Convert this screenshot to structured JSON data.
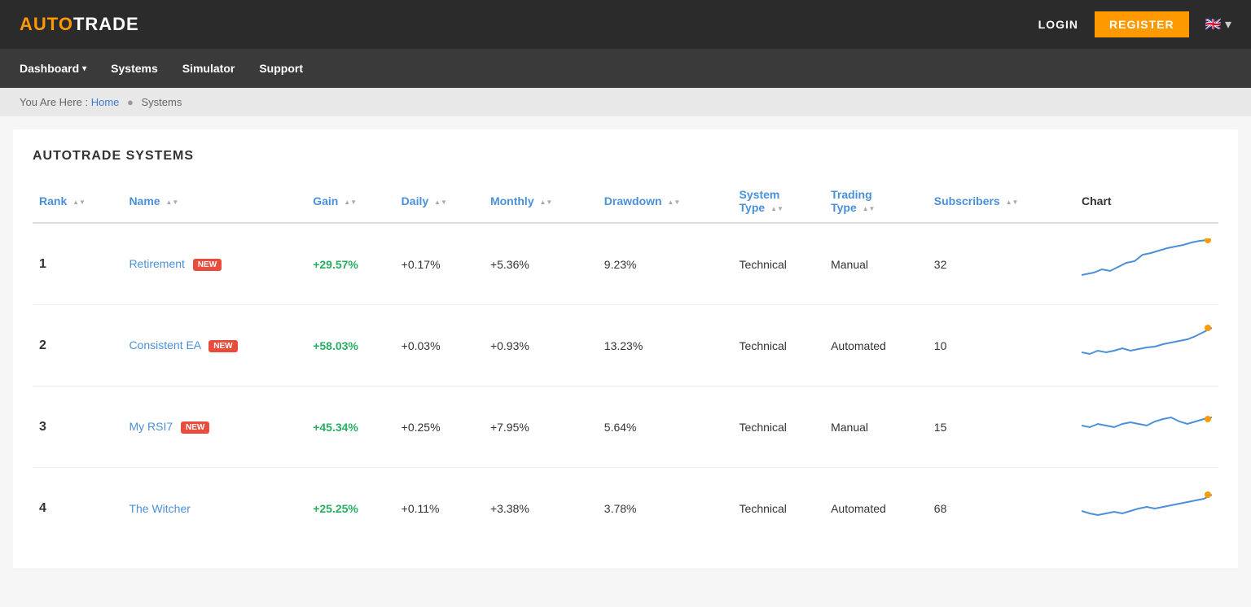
{
  "header": {
    "logo_auto": "AUTO",
    "logo_trade": "TRADE",
    "login_label": "LOGIN",
    "register_label": "REGISTER",
    "flag": "🇬🇧"
  },
  "nav": {
    "items": [
      {
        "label": "Dashboard",
        "has_caret": true
      },
      {
        "label": "Systems",
        "has_caret": false
      },
      {
        "label": "Simulator",
        "has_caret": false
      },
      {
        "label": "Support",
        "has_caret": false
      }
    ]
  },
  "breadcrumb": {
    "you_are_here": "You Are Here :",
    "home_label": "Home",
    "sep": "●",
    "current": "Systems"
  },
  "section_title": "AUTOTRADE SYSTEMS",
  "table": {
    "columns": [
      {
        "key": "rank",
        "label": "Rank",
        "sortable": true,
        "dark": false
      },
      {
        "key": "name",
        "label": "Name",
        "sortable": true,
        "dark": false
      },
      {
        "key": "gain",
        "label": "Gain",
        "sortable": true,
        "dark": false
      },
      {
        "key": "daily",
        "label": "Daily",
        "sortable": true,
        "dark": false
      },
      {
        "key": "monthly",
        "label": "Monthly",
        "sortable": true,
        "dark": false
      },
      {
        "key": "drawdown",
        "label": "Drawdown",
        "sortable": true,
        "dark": false
      },
      {
        "key": "system_type",
        "label": "System Type",
        "sortable": true,
        "dark": false
      },
      {
        "key": "trading_type",
        "label": "Trading Type",
        "sortable": true,
        "dark": false
      },
      {
        "key": "subscribers",
        "label": "Subscribers",
        "sortable": true,
        "dark": false
      },
      {
        "key": "chart",
        "label": "Chart",
        "sortable": false,
        "dark": true
      }
    ],
    "rows": [
      {
        "rank": "1",
        "name": "Retirement",
        "new": true,
        "gain": "+29.57%",
        "daily": "+0.17%",
        "monthly": "+5.36%",
        "drawdown": "9.23%",
        "system_type": "Technical",
        "trading_type": "Manual",
        "subscribers": "32",
        "sparkline": "row1"
      },
      {
        "rank": "2",
        "name": "Consistent EA",
        "new": true,
        "gain": "+58.03%",
        "daily": "+0.03%",
        "monthly": "+0.93%",
        "drawdown": "13.23%",
        "system_type": "Technical",
        "trading_type": "Automated",
        "subscribers": "10",
        "sparkline": "row2"
      },
      {
        "rank": "3",
        "name": "My RSI7",
        "new": true,
        "gain": "+45.34%",
        "daily": "+0.25%",
        "monthly": "+7.95%",
        "drawdown": "5.64%",
        "system_type": "Technical",
        "trading_type": "Manual",
        "subscribers": "15",
        "sparkline": "row3"
      },
      {
        "rank": "4",
        "name": "The Witcher",
        "new": false,
        "gain": "+25.25%",
        "daily": "+0.11%",
        "monthly": "+3.38%",
        "drawdown": "3.78%",
        "system_type": "Technical",
        "trading_type": "Automated",
        "subscribers": "68",
        "sparkline": "row4"
      }
    ]
  }
}
